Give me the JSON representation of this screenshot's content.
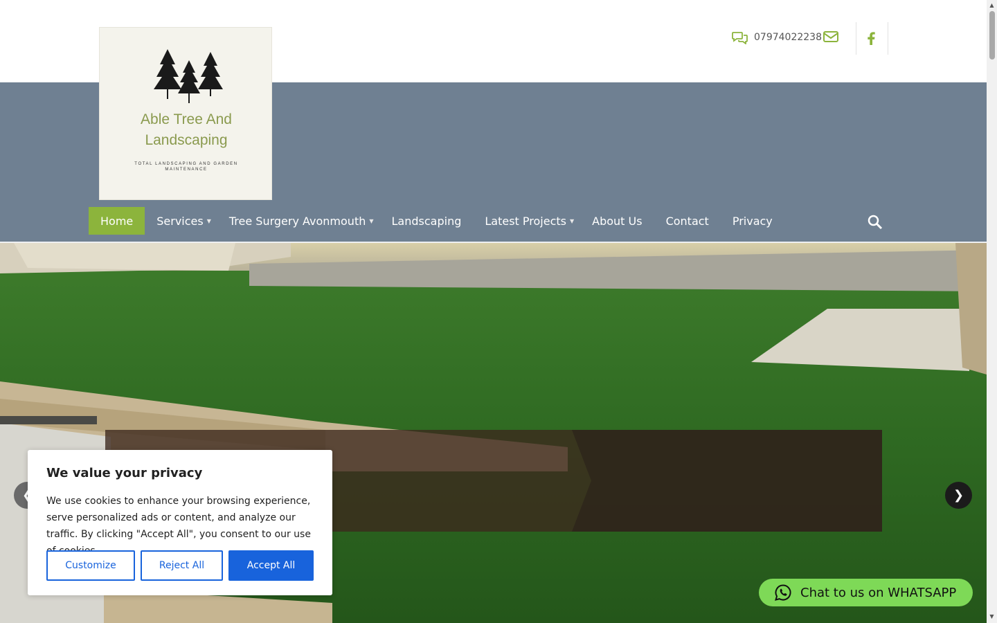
{
  "header": {
    "phone": "07974022238",
    "icons": {
      "chat": "chat-bubbles-icon",
      "mail": "envelope-icon",
      "social": "facebook-icon"
    },
    "accent": "#8cb43c"
  },
  "logo": {
    "title": "Able Tree And Landscaping",
    "tagline": "TOTAL LANDSCAPING AND GARDEN MAINTENANCE",
    "title_color": "#8a9a4e"
  },
  "nav": {
    "items": [
      {
        "label": "Home",
        "active": true
      },
      {
        "label": "Services",
        "has_dropdown": true
      },
      {
        "label": "Tree Surgery Avonmouth",
        "has_dropdown": true
      },
      {
        "label": "Landscaping"
      },
      {
        "label": "Latest Projects",
        "has_dropdown": true
      },
      {
        "label": "About Us"
      },
      {
        "label": "Contact"
      },
      {
        "label": "Privacy"
      }
    ],
    "background": "#6f8092",
    "search_icon": "search-icon"
  },
  "hero": {
    "prev_icon": "chevron-left-icon",
    "next_icon": "chevron-right-icon"
  },
  "cookie": {
    "title": "We value your privacy",
    "text": "We use cookies to enhance your browsing experience, serve personalized ads or content, and analyze our traffic. By clicking \"Accept All\", you consent to our use of cookies.",
    "customize": "Customize",
    "reject": "Reject All",
    "accept": "Accept All",
    "button_color": "#1863dc"
  },
  "whatsapp": {
    "label": "Chat to us on WHATSAPP",
    "icon": "whatsapp-icon",
    "color": "#7ed957"
  }
}
